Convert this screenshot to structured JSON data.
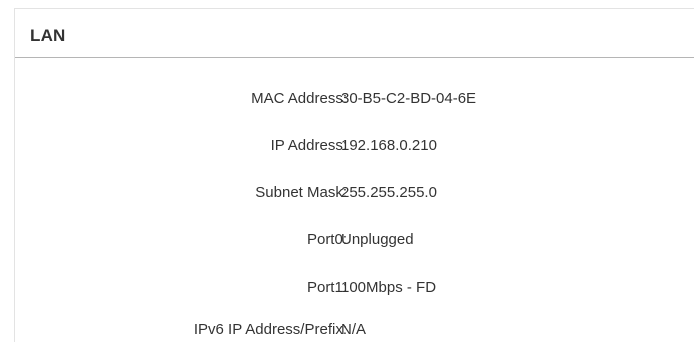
{
  "section": {
    "title": "LAN"
  },
  "fields": [
    {
      "label": "MAC Address:",
      "value": "30-B5-C2-BD-04-6E"
    },
    {
      "label": "IP Address:",
      "value": "192.168.0.210"
    },
    {
      "label": "Subnet Mask:",
      "value": "255.255.255.0"
    },
    {
      "label": "Port0:",
      "value": "Unplugged"
    },
    {
      "label": "Port1:",
      "value": "100Mbps - FD"
    },
    {
      "label": "IPv6 IP Address/Prefix:",
      "value": "N/A"
    }
  ]
}
